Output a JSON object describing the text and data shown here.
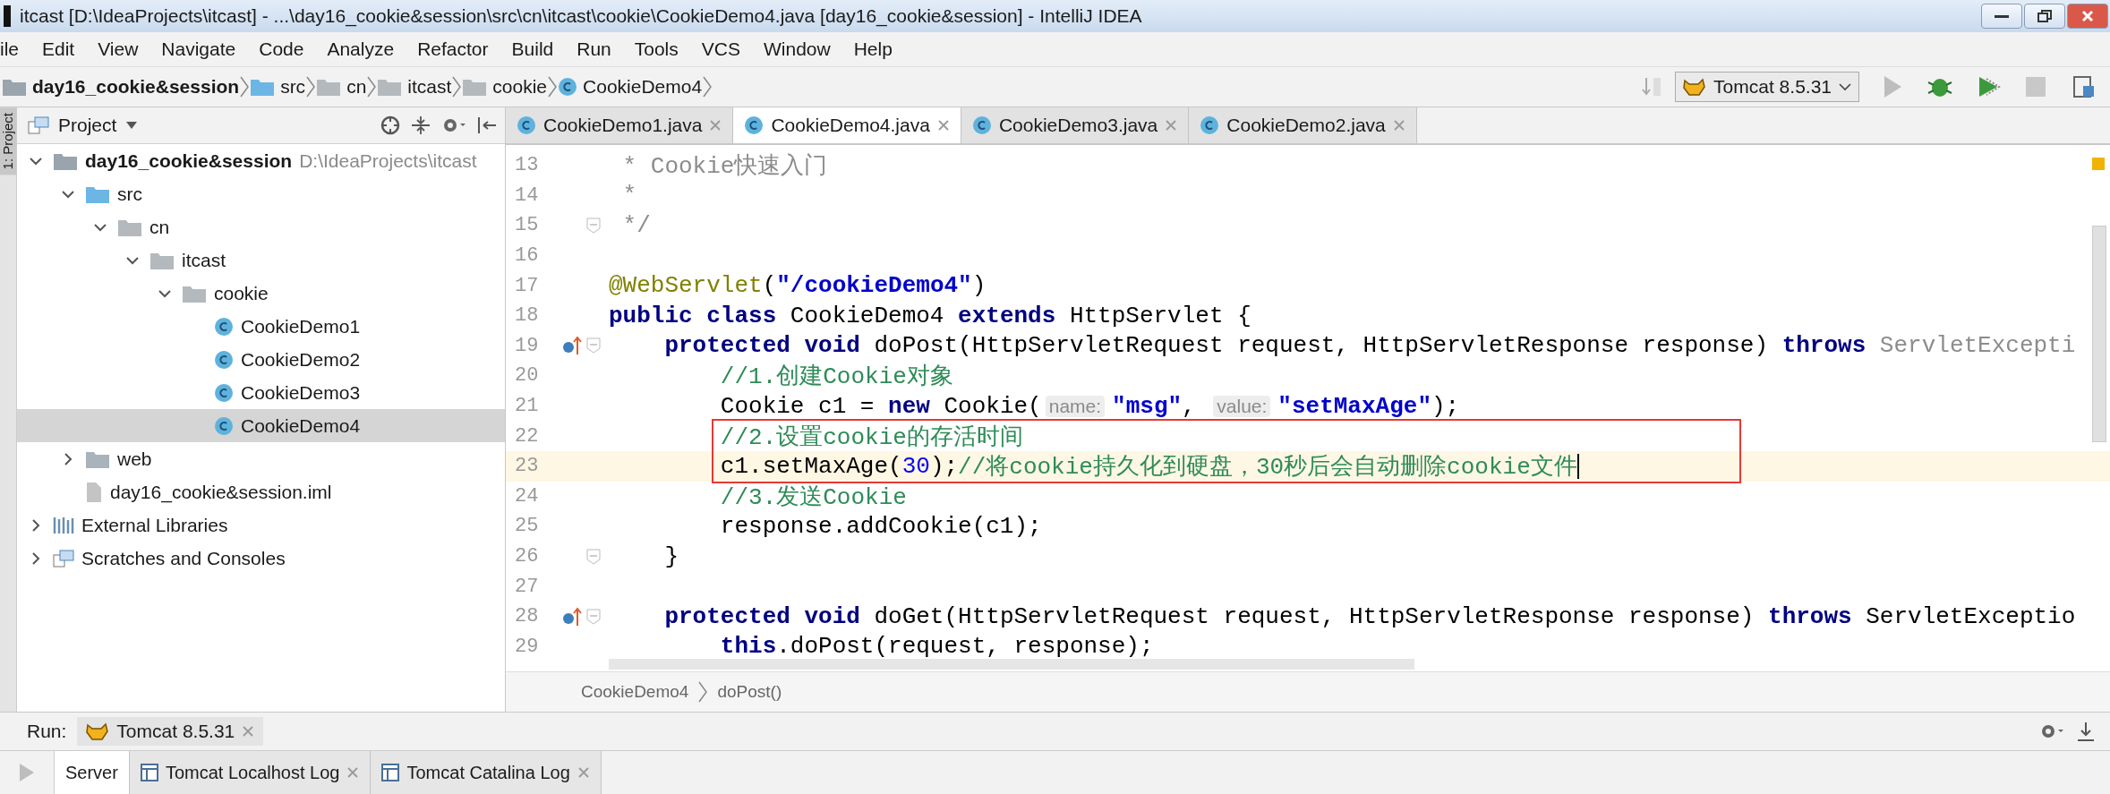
{
  "window": {
    "title": "itcast [D:\\IdeaProjects\\itcast] - ...\\day16_cookie&session\\src\\cn\\itcast\\cookie\\CookieDemo4.java [day16_cookie&session] - IntelliJ IDEA"
  },
  "menu": [
    "ile",
    "Edit",
    "View",
    "Navigate",
    "Code",
    "Analyze",
    "Refactor",
    "Build",
    "Run",
    "Tools",
    "VCS",
    "Window",
    "Help"
  ],
  "nav_bar": {
    "crumbs": [
      {
        "label": "day16_cookie&session",
        "kind": "module"
      },
      {
        "label": "src",
        "kind": "source"
      },
      {
        "label": "cn",
        "kind": "package"
      },
      {
        "label": "itcast",
        "kind": "package"
      },
      {
        "label": "cookie",
        "kind": "package"
      },
      {
        "label": "CookieDemo4",
        "kind": "class"
      }
    ],
    "run_config": "Tomcat 8.5.31"
  },
  "side_strip": {
    "label": "1: Project"
  },
  "project_panel": {
    "title": "Project",
    "tree": [
      {
        "label": "day16_cookie&session",
        "kind": "module",
        "path": "D:\\IdeaProjects\\itcast",
        "expanded": true,
        "selected": false,
        "children": [
          {
            "label": "src",
            "kind": "source",
            "expanded": true,
            "selected": false,
            "children": [
              {
                "label": "cn",
                "kind": "package",
                "expanded": true,
                "selected": false,
                "children": [
                  {
                    "label": "itcast",
                    "kind": "package",
                    "expanded": true,
                    "selected": false,
                    "children": [
                      {
                        "label": "cookie",
                        "kind": "package",
                        "expanded": true,
                        "selected": false,
                        "children": [
                          {
                            "label": "CookieDemo1",
                            "kind": "class",
                            "selected": false
                          },
                          {
                            "label": "CookieDemo2",
                            "kind": "class",
                            "selected": false
                          },
                          {
                            "label": "CookieDemo3",
                            "kind": "class",
                            "selected": false
                          },
                          {
                            "label": "CookieDemo4",
                            "kind": "class",
                            "selected": true
                          }
                        ]
                      }
                    ]
                  }
                ]
              }
            ]
          },
          {
            "label": "web",
            "kind": "web",
            "expanded": false,
            "selected": false
          },
          {
            "label": "day16_cookie&session.iml",
            "kind": "file",
            "selected": false
          }
        ]
      },
      {
        "label": "External Libraries",
        "kind": "libraries",
        "expanded": false,
        "selected": false
      },
      {
        "label": "Scratches and Consoles",
        "kind": "scratches",
        "expanded": false,
        "selected": false
      }
    ]
  },
  "editor": {
    "tabs": [
      {
        "label": "CookieDemo1.java",
        "selected": false
      },
      {
        "label": "CookieDemo4.java",
        "selected": true
      },
      {
        "label": "CookieDemo3.java",
        "selected": false
      },
      {
        "label": "CookieDemo2.java",
        "selected": false
      }
    ],
    "lines": [
      {
        "num": "13",
        "fold": false,
        "override": false,
        "current": false,
        "boxed": false,
        "tokens": [
          {
            "kind": "doc",
            "text": " * Cookie快速入门"
          }
        ]
      },
      {
        "num": "14",
        "fold": false,
        "override": false,
        "current": false,
        "boxed": false,
        "tokens": [
          {
            "kind": "doc",
            "text": " *"
          }
        ]
      },
      {
        "num": "15",
        "fold": true,
        "override": false,
        "current": false,
        "boxed": false,
        "tokens": [
          {
            "kind": "doc",
            "text": " */"
          }
        ]
      },
      {
        "num": "16",
        "fold": false,
        "override": false,
        "current": false,
        "boxed": false
      },
      {
        "num": "17",
        "fold": false,
        "override": false,
        "current": false,
        "boxed": false,
        "tokens": [
          {
            "kind": "annotation",
            "text": "@WebServlet"
          },
          {
            "kind": "plain",
            "text": "("
          },
          {
            "kind": "string",
            "text": "\"/cookieDemo4\""
          },
          {
            "kind": "plain",
            "text": ")"
          }
        ]
      },
      {
        "num": "18",
        "fold": false,
        "override": false,
        "current": false,
        "boxed": false,
        "tokens": [
          {
            "kind": "keyword",
            "text": "public class"
          },
          {
            "kind": "plain",
            "text": " CookieDemo4 "
          },
          {
            "kind": "keyword",
            "text": "extends"
          },
          {
            "kind": "plain",
            "text": " HttpServlet {"
          }
        ]
      },
      {
        "num": "19",
        "fold": true,
        "override": true,
        "current": false,
        "boxed": false,
        "tokens": [
          {
            "kind": "keyword",
            "text": "    protected void"
          },
          {
            "kind": "plain",
            "text": " doPost(HttpServletRequest request, HttpServletResponse response) "
          },
          {
            "kind": "keyword",
            "text": "throws"
          },
          {
            "kind": "muted",
            "text": " ServletExcepti"
          }
        ]
      },
      {
        "num": "20",
        "fold": false,
        "override": false,
        "current": false,
        "boxed": false,
        "tokens": [
          {
            "kind": "comment",
            "text": "        //1.创建Cookie对象"
          }
        ]
      },
      {
        "num": "21",
        "fold": false,
        "override": false,
        "current": false,
        "boxed": false,
        "tokens": [
          {
            "kind": "plain",
            "text": "        Cookie c1 = "
          },
          {
            "kind": "keyword",
            "text": "new"
          },
          {
            "kind": "plain",
            "text": " Cookie("
          },
          {
            "kind": "hint",
            "text": "name:"
          },
          {
            "kind": "string",
            "text": "\"msg\""
          },
          {
            "kind": "plain",
            "text": ", "
          },
          {
            "kind": "hint",
            "text": "value:"
          },
          {
            "kind": "string",
            "text": "\"setMaxAge\""
          },
          {
            "kind": "plain",
            "text": ");"
          }
        ]
      },
      {
        "num": "22",
        "fold": false,
        "override": false,
        "current": false,
        "boxed": true,
        "tokens": [
          {
            "kind": "comment",
            "text": "        //2.设置cookie的存活时间"
          }
        ]
      },
      {
        "num": "23",
        "fold": false,
        "override": false,
        "current": true,
        "boxed": true,
        "tokens": [
          {
            "kind": "plain",
            "text": "        c1.setMaxAge("
          },
          {
            "kind": "number",
            "text": "30"
          },
          {
            "kind": "plain",
            "text": ");"
          },
          {
            "kind": "comment",
            "text": "//将cookie持久化到硬盘，30秒后会自动删除cookie文件"
          }
        ]
      },
      {
        "num": "24",
        "fold": false,
        "override": false,
        "current": false,
        "boxed": false,
        "tokens": [
          {
            "kind": "comment",
            "text": "        //3.发送Cookie"
          }
        ]
      },
      {
        "num": "25",
        "fold": false,
        "override": false,
        "current": false,
        "boxed": false,
        "tokens": [
          {
            "kind": "plain",
            "text": "        response.addCookie(c1);"
          }
        ]
      },
      {
        "num": "26",
        "fold": true,
        "override": false,
        "current": false,
        "boxed": false,
        "tokens": [
          {
            "kind": "plain",
            "text": "    }"
          }
        ]
      },
      {
        "num": "27",
        "fold": false,
        "override": false,
        "current": false,
        "boxed": false
      },
      {
        "num": "28",
        "fold": true,
        "override": true,
        "current": false,
        "boxed": false,
        "tokens": [
          {
            "kind": "keyword",
            "text": "    protected void"
          },
          {
            "kind": "plain",
            "text": " doGet(HttpServletRequest request, HttpServletResponse response) "
          },
          {
            "kind": "keyword",
            "text": "throws"
          },
          {
            "kind": "plain",
            "text": " ServletExceptio"
          }
        ]
      },
      {
        "num": "29",
        "fold": false,
        "override": false,
        "current": false,
        "boxed": false,
        "tokens": [
          {
            "kind": "keyword",
            "text": "        this"
          },
          {
            "kind": "plain",
            "text": ".doPost(request, response);"
          }
        ]
      }
    ],
    "breadcrumb": [
      "CookieDemo4",
      "doPost()"
    ]
  },
  "run_panel": {
    "label": "Run:",
    "config_tab": "Tomcat 8.5.31",
    "tabs": [
      {
        "label": "Server",
        "selected": true,
        "closable": false
      },
      {
        "label": "Tomcat Localhost Log",
        "selected": false,
        "closable": true
      },
      {
        "label": "Tomcat Catalina Log",
        "selected": false,
        "closable": true
      }
    ]
  }
}
